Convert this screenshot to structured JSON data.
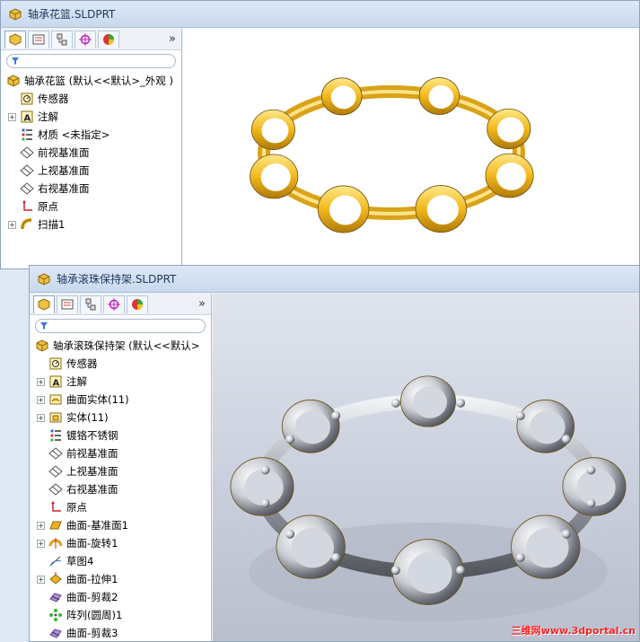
{
  "window1": {
    "title": "轴承花篮.SLDPRT",
    "tree": [
      {
        "label": "轴承花篮  (默认<<默认>_外观 )",
        "icon": "part-icon",
        "expand": ""
      },
      {
        "label": "传感器",
        "icon": "sensor-icon",
        "expand": ""
      },
      {
        "label": "注解",
        "icon": "annotation-icon",
        "expand": "+"
      },
      {
        "label": "材质 <未指定>",
        "icon": "material-icon",
        "expand": ""
      },
      {
        "label": "前视基准面",
        "icon": "plane-icon",
        "expand": ""
      },
      {
        "label": "上视基准面",
        "icon": "plane-icon",
        "expand": ""
      },
      {
        "label": "右视基准面",
        "icon": "plane-icon",
        "expand": ""
      },
      {
        "label": "原点",
        "icon": "origin-icon",
        "expand": ""
      },
      {
        "label": "扫描1",
        "icon": "sweep-icon",
        "expand": "+"
      }
    ]
  },
  "window2": {
    "title": "轴承滚珠保持架.SLDPRT",
    "tree": [
      {
        "label": "轴承滚珠保持架  (默认<<默认>",
        "icon": "part-icon",
        "expand": ""
      },
      {
        "label": "传感器",
        "icon": "sensor-icon",
        "expand": ""
      },
      {
        "label": "注解",
        "icon": "annotation-icon",
        "expand": "+"
      },
      {
        "label": "曲面实体(11)",
        "icon": "surface-body-icon",
        "expand": "+"
      },
      {
        "label": "实体(11)",
        "icon": "solid-body-icon",
        "expand": "+"
      },
      {
        "label": "镀铬不锈钢",
        "icon": "material-icon",
        "expand": ""
      },
      {
        "label": "前视基准面",
        "icon": "plane-icon",
        "expand": ""
      },
      {
        "label": "上视基准面",
        "icon": "plane-icon",
        "expand": ""
      },
      {
        "label": "右视基准面",
        "icon": "plane-icon",
        "expand": ""
      },
      {
        "label": "原点",
        "icon": "origin-icon",
        "expand": ""
      },
      {
        "label": "曲面-基准面1",
        "icon": "surface-plane-icon",
        "expand": "+"
      },
      {
        "label": "曲面-旋转1",
        "icon": "surface-revolve-icon",
        "expand": "+"
      },
      {
        "label": "草图4",
        "icon": "sketch-icon",
        "expand": ""
      },
      {
        "label": "曲面-拉伸1",
        "icon": "surface-extrude-icon",
        "expand": "+"
      },
      {
        "label": "曲面-剪裁2",
        "icon": "surface-trim-icon",
        "expand": ""
      },
      {
        "label": "阵列(圆周)1",
        "icon": "circular-pattern-icon",
        "expand": ""
      },
      {
        "label": "曲面-剪裁3",
        "icon": "surface-trim-icon",
        "expand": ""
      }
    ]
  },
  "tabs_more": "»",
  "watermark": "三维网www.3dportal.cn"
}
